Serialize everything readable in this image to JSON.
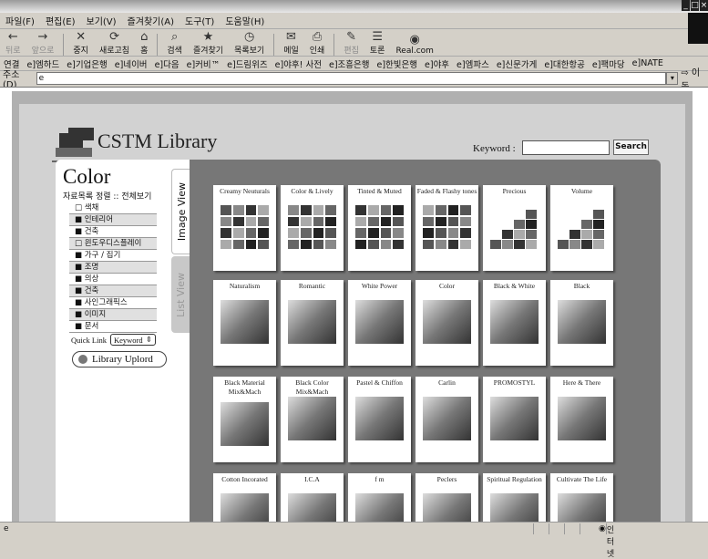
{
  "browser": {
    "menu": [
      "파일(F)",
      "편집(E)",
      "보기(V)",
      "즐겨찾기(A)",
      "도구(T)",
      "도움말(H)"
    ],
    "toolbar": [
      {
        "label": "뒤로",
        "icon": "back-arrow-icon",
        "symbol": "←",
        "enabled": false
      },
      {
        "label": "앞으로",
        "icon": "forward-arrow-icon",
        "symbol": "→",
        "enabled": false
      },
      {
        "label": "중지",
        "icon": "stop-icon",
        "symbol": "✕",
        "enabled": true
      },
      {
        "label": "새로고침",
        "icon": "refresh-icon",
        "symbol": "⟳",
        "enabled": true
      },
      {
        "label": "홈",
        "icon": "home-icon",
        "symbol": "⌂",
        "enabled": true
      },
      {
        "label": "검색",
        "icon": "search-icon",
        "symbol": "⌕",
        "enabled": true
      },
      {
        "label": "즐겨찾기",
        "icon": "favorites-icon",
        "symbol": "★",
        "enabled": true
      },
      {
        "label": "목록보기",
        "icon": "history-icon",
        "symbol": "◷",
        "enabled": true
      },
      {
        "label": "메일",
        "icon": "mail-icon",
        "symbol": "✉",
        "enabled": true
      },
      {
        "label": "인쇄",
        "icon": "print-icon",
        "symbol": "⎙",
        "enabled": true
      },
      {
        "label": "편집",
        "icon": "edit-icon",
        "symbol": "✎",
        "enabled": false
      },
      {
        "label": "토론",
        "icon": "discuss-icon",
        "symbol": "☰",
        "enabled": true
      },
      {
        "label": "Real.com",
        "icon": "real-icon",
        "symbol": "◉",
        "enabled": true
      }
    ],
    "links_label": "연결",
    "links": [
      "e]엠하드",
      "e]기업은행",
      "e]네이버",
      "e]다음",
      "e]커비™",
      "e]드림위즈",
      "e]야후! 사전",
      "e]조흥은행",
      "e]한빛은행",
      "e]야후",
      "e]엠파스",
      "e]신문가게",
      "e]대한항공",
      "e]팩마당",
      "e]NATE"
    ],
    "address_label": "주소(D)",
    "address_value": "",
    "go_label": "이동",
    "status_zone": "인터넷"
  },
  "site": {
    "logo": "CSTM Library",
    "keyword_label": "Keyword :",
    "search_button": "Search",
    "category_title": "Color",
    "category_header": "자료목록 정렬 :: 전체보기",
    "categories": [
      "색채",
      "인테리어",
      "건축",
      "윈도우디스플레이",
      "가구 / 집기",
      "조명",
      "의상",
      "건축",
      "사인그래픽스",
      "이미지",
      "문서"
    ],
    "quick_link_label": "Quick Link",
    "quick_link_value": "Keyword",
    "upload_button": "Library Uplord",
    "tabs": [
      "Image View",
      "List View"
    ]
  },
  "cards": [
    {
      "title": "Creamy Neuturals",
      "thumb": "cols"
    },
    {
      "title": "Color & Lively",
      "thumb": "cols"
    },
    {
      "title": "Tinted & Muted",
      "thumb": "cols"
    },
    {
      "title": "Faded & Flashy tones",
      "thumb": "cols"
    },
    {
      "title": "Precious",
      "thumb": "stairs"
    },
    {
      "title": "Volume",
      "thumb": "stairs"
    },
    {
      "title": "Naturalism",
      "thumb": "photo"
    },
    {
      "title": "Romantic",
      "thumb": "photo"
    },
    {
      "title": "White Power",
      "thumb": "photo"
    },
    {
      "title": "Color",
      "thumb": "photo"
    },
    {
      "title": "Black & White",
      "thumb": "photo"
    },
    {
      "title": "Black",
      "thumb": "photo"
    },
    {
      "title": "Black Material Mix&Mach",
      "thumb": "photo"
    },
    {
      "title": "Black Color Mix&Mach",
      "thumb": "photo"
    },
    {
      "title": "Pastel & Chiffon",
      "thumb": "photo"
    },
    {
      "title": "Carlin",
      "thumb": "photo"
    },
    {
      "title": "PROMOSTYL",
      "thumb": "photo"
    },
    {
      "title": "Here & There",
      "thumb": "photo"
    },
    {
      "title": "Cotton Incorated",
      "thumb": "photo"
    },
    {
      "title": "I.C.A",
      "thumb": "photo"
    },
    {
      "title": "f m",
      "thumb": "photo"
    },
    {
      "title": "Peclers",
      "thumb": "photo"
    },
    {
      "title": "Spiritual Regulation",
      "thumb": "photo"
    },
    {
      "title": "Cultivate The Life",
      "thumb": "photo"
    }
  ]
}
